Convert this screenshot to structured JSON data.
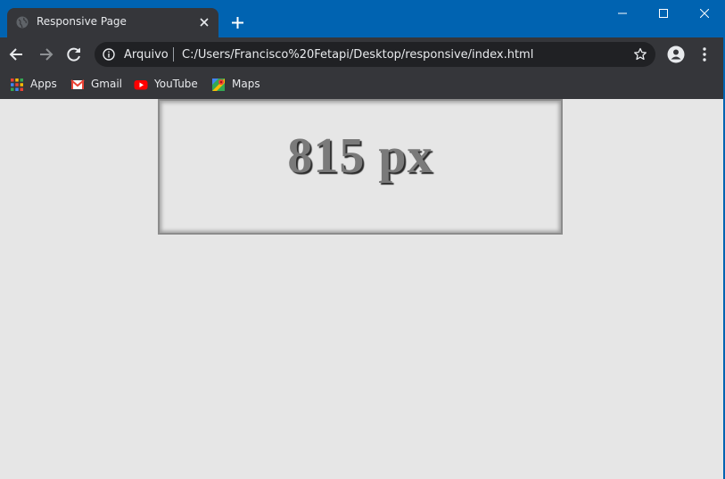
{
  "window": {
    "titlebar_color": "#0063b1",
    "tab": {
      "title": "Responsive Page",
      "favicon": "globe-icon"
    },
    "controls": [
      "minimize-icon",
      "maximize-icon",
      "close-icon"
    ]
  },
  "toolbar": {
    "omnibox": {
      "security_label": "Arquivo",
      "url": "C:/Users/Francisco%20Fetapi/Desktop/responsive/index.html"
    }
  },
  "bookmarks": [
    {
      "label": "Apps",
      "icon": "apps-grid-icon"
    },
    {
      "label": "Gmail",
      "icon": "gmail-icon"
    },
    {
      "label": "YouTube",
      "icon": "youtube-icon"
    },
    {
      "label": "Maps",
      "icon": "maps-icon"
    }
  ],
  "page": {
    "width_display": "815 px",
    "background": "#e6e6e6"
  }
}
